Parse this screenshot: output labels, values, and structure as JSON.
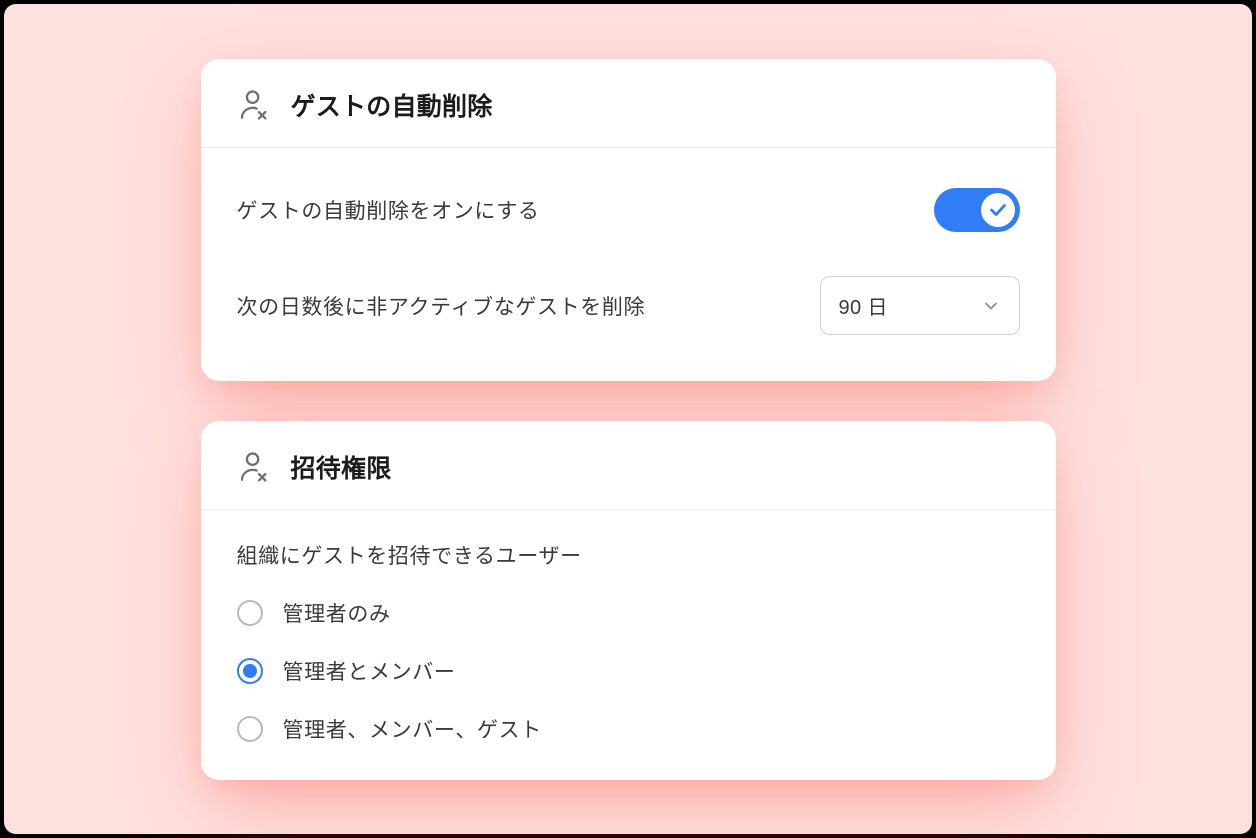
{
  "auto_delete": {
    "title": "ゲストの自動削除",
    "toggle_label": "ゲストの自動削除をオンにする",
    "toggle_on": true,
    "days_label": "次の日数後に非アクティブなゲストを削除",
    "days_value": "90 日"
  },
  "invite_permissions": {
    "title": "招待権限",
    "prompt": "組織にゲストを招待できるユーザー",
    "options": [
      {
        "label": "管理者のみ",
        "selected": false
      },
      {
        "label": "管理者とメンバー",
        "selected": true
      },
      {
        "label": "管理者、メンバー、ゲスト",
        "selected": false
      }
    ]
  },
  "colors": {
    "accent": "#307df6",
    "backdrop": "#ffe1df"
  }
}
